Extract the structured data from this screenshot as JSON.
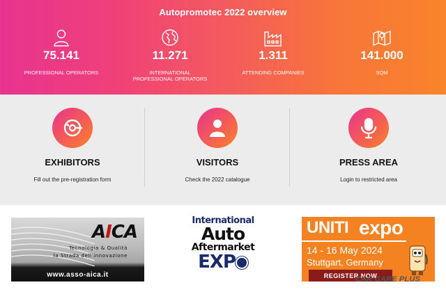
{
  "overview": {
    "title": "Autopromotec 2022 overview",
    "stats": [
      {
        "icon": "user-icon",
        "value": "75.141",
        "label": "PROFESSIONAL OPERATORS"
      },
      {
        "icon": "globe-icon",
        "value": "11.271",
        "label": "INTERNATIONAL PROFESSIONAL OPERATORS"
      },
      {
        "icon": "factory-icon",
        "value": "1.311",
        "label": "ATTENDING COMPANIES"
      },
      {
        "icon": "map-icon",
        "value": "141.000",
        "label": "SQM"
      }
    ]
  },
  "cards": [
    {
      "icon": "wrench-icon",
      "title": "EXHIBITORS",
      "subtitle": "Fill out the pre-registration form"
    },
    {
      "icon": "person-icon",
      "title": "VISITORS",
      "subtitle": "Check the 2022 catalogue"
    },
    {
      "icon": "microphone-icon",
      "title": "PRESS AREA",
      "subtitle": "Login to restricted area"
    }
  ],
  "logos": {
    "aica": {
      "brand_a": "A",
      "brand_i": "I",
      "brand_rest": "CA",
      "tagline1": "Tecnologia & Qualità",
      "tagline2": "la Strada dell'Innovazione",
      "url": "www.asso-aica.it"
    },
    "iaae": {
      "line1": "International",
      "line2": "Auto",
      "line3": "Aftermarket",
      "line4": "EXP",
      "line4_end": ""
    },
    "uniti": {
      "brand1": "UNITI",
      "brand2": "expo",
      "dates": "14 - 16 May 2024",
      "place": "Stuttgart, Germany",
      "register": "REGISTER NOW"
    }
  },
  "watermark": {
    "text": "CAR CARE PLUS"
  },
  "colors": {
    "gradient_start": "#e8338f",
    "gradient_end": "#f9842a",
    "card_bg": "#ececec",
    "uniti_orange": "#f58220",
    "iaae_blue": "#1b2a6b"
  }
}
